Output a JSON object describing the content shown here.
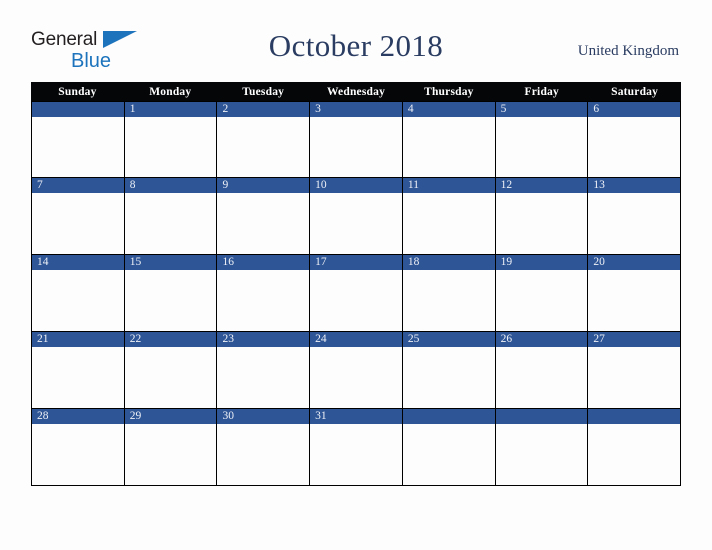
{
  "brand": {
    "logo_word_one": "General",
    "logo_word_two": "Blue",
    "logo_flag_icon": "blue-triangle-flag-icon",
    "dark_color": "#231f20",
    "blue_color": "#1d74bd"
  },
  "header": {
    "title": "October 2018",
    "region": "United Kingdom",
    "title_color": "#2a3c61"
  },
  "calendar": {
    "month": "October",
    "year": "2018",
    "accent_color": "#2e5596",
    "weekday_header_bg": "#050608",
    "weekday_header_color": "#ffffff",
    "weekdays": [
      "Sunday",
      "Monday",
      "Tuesday",
      "Wednesday",
      "Thursday",
      "Friday",
      "Saturday"
    ],
    "weeks": [
      [
        {
          "day": ""
        },
        {
          "day": "1"
        },
        {
          "day": "2"
        },
        {
          "day": "3"
        },
        {
          "day": "4"
        },
        {
          "day": "5"
        },
        {
          "day": "6"
        }
      ],
      [
        {
          "day": "7"
        },
        {
          "day": "8"
        },
        {
          "day": "9"
        },
        {
          "day": "10"
        },
        {
          "day": "11"
        },
        {
          "day": "12"
        },
        {
          "day": "13"
        }
      ],
      [
        {
          "day": "14"
        },
        {
          "day": "15"
        },
        {
          "day": "16"
        },
        {
          "day": "17"
        },
        {
          "day": "18"
        },
        {
          "day": "19"
        },
        {
          "day": "20"
        }
      ],
      [
        {
          "day": "21"
        },
        {
          "day": "22"
        },
        {
          "day": "23"
        },
        {
          "day": "24"
        },
        {
          "day": "25"
        },
        {
          "day": "26"
        },
        {
          "day": "27"
        }
      ],
      [
        {
          "day": "28"
        },
        {
          "day": "29"
        },
        {
          "day": "30"
        },
        {
          "day": "31"
        },
        {
          "day": ""
        },
        {
          "day": ""
        },
        {
          "day": ""
        }
      ]
    ]
  }
}
